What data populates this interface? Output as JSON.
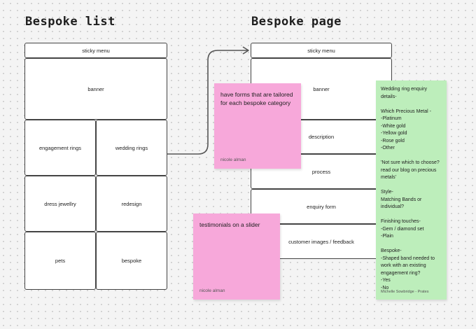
{
  "headings": {
    "list_title": "Bespoke list",
    "page_title": "Bespoke page"
  },
  "bespoke_list": {
    "sticky_menu": "sticky menu",
    "banner": "banner",
    "tiles": [
      "engagement rings",
      "wedding rings",
      "dress jewellry",
      "redesign",
      "pets",
      "bespoke"
    ]
  },
  "bespoke_page": {
    "sticky_menu": "sticky menu",
    "sections": [
      "banner",
      "description",
      "process",
      "enquiry form",
      "customer images / feedback"
    ]
  },
  "notes": {
    "forms": {
      "text": "have forms that are tailored for each bespoke category",
      "author": "nicole alman",
      "color": "#f7a8da"
    },
    "testimonials": {
      "text": "testimonials on a slider",
      "author": "nicole alman",
      "color": "#f7a8da"
    },
    "enquiry": {
      "text": "Wedding ring enquiry details-\n\nWhich Precious Metal -\n-Platinum\n-White gold\n-Yellow gold\n-Rose gold\n-Other\n\n'Not sure which to choose? read our blog on precious metals'\n\nStyle-\nMatching Bands or individual?\n\nFinishing touches-\n-Gem / diamond set\n-Plain\n\nBespoke-\n-Shaped band needed to work with an existing engagement ring?\n-Yes\n-No",
      "author": "Michelle Sowbridge - Prates",
      "color": "#bdeebb"
    }
  },
  "colors": {
    "outline": "#444444",
    "connector": "#555555"
  }
}
